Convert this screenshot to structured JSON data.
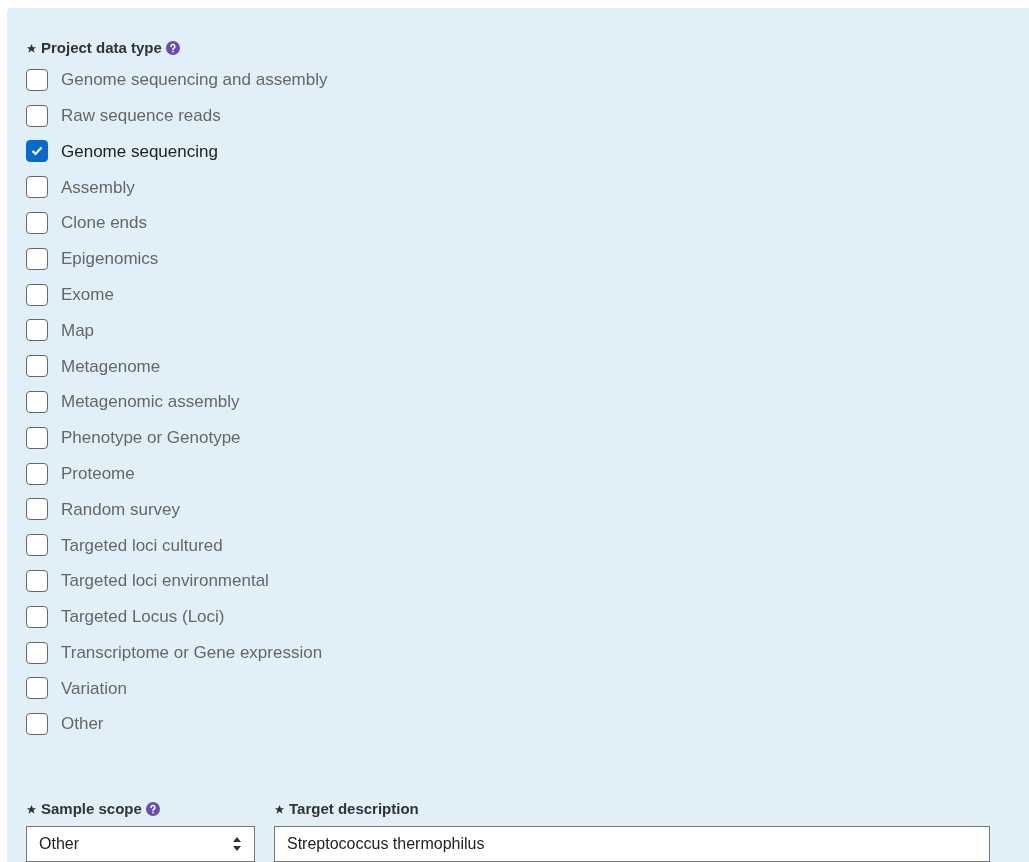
{
  "data_type": {
    "label": "Project data type",
    "options": [
      {
        "label": "Genome sequencing and assembly",
        "checked": false
      },
      {
        "label": "Raw sequence reads",
        "checked": false
      },
      {
        "label": "Genome sequencing",
        "checked": true
      },
      {
        "label": "Assembly",
        "checked": false
      },
      {
        "label": "Clone ends",
        "checked": false
      },
      {
        "label": "Epigenomics",
        "checked": false
      },
      {
        "label": "Exome",
        "checked": false
      },
      {
        "label": "Map",
        "checked": false
      },
      {
        "label": "Metagenome",
        "checked": false
      },
      {
        "label": "Metagenomic assembly",
        "checked": false
      },
      {
        "label": "Phenotype or Genotype",
        "checked": false
      },
      {
        "label": "Proteome",
        "checked": false
      },
      {
        "label": "Random survey",
        "checked": false
      },
      {
        "label": "Targeted loci cultured",
        "checked": false
      },
      {
        "label": "Targeted loci environmental",
        "checked": false
      },
      {
        "label": "Targeted Locus (Loci)",
        "checked": false
      },
      {
        "label": "Transcriptome or Gene expression",
        "checked": false
      },
      {
        "label": "Variation",
        "checked": false
      },
      {
        "label": "Other",
        "checked": false
      }
    ]
  },
  "sample_scope": {
    "label": "Sample scope",
    "value": "Other"
  },
  "target_description": {
    "label": "Target description",
    "value": "Streptococcus thermophilus"
  }
}
